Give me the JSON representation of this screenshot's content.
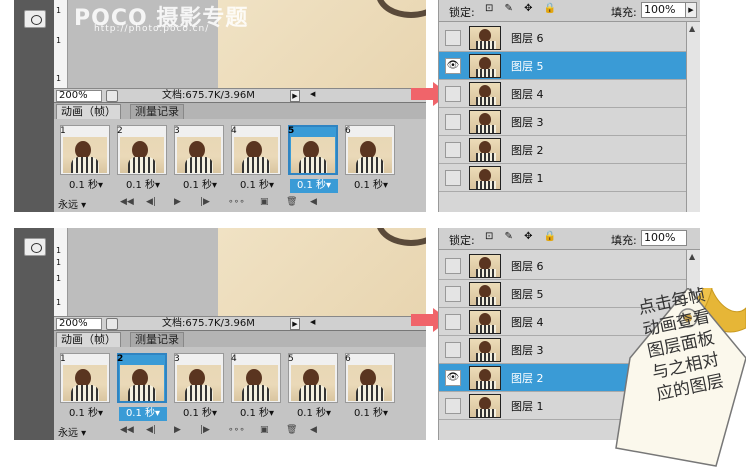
{
  "watermark": {
    "brand": "POCO 摄影专题",
    "url": "http://photo.poco.cn/"
  },
  "top_panel": {
    "zoom": "200%",
    "doc_info": "文档:675.7K/3.96M",
    "ruler_marks": [
      "1",
      "1",
      "1"
    ],
    "tabs": {
      "animation": "动画（帧）",
      "measure": "测量记录"
    },
    "frames": [
      {
        "num": "1",
        "delay": "0.1 秒▾"
      },
      {
        "num": "2",
        "delay": "0.1 秒▾"
      },
      {
        "num": "3",
        "delay": "0.1 秒▾"
      },
      {
        "num": "4",
        "delay": "0.1 秒▾"
      },
      {
        "num": "5",
        "delay": "0.1 秒▾"
      },
      {
        "num": "6",
        "delay": "0.1 秒▾"
      }
    ],
    "selected_frame": 5,
    "loop": "永远 ▾",
    "controls": [
      "◀◀",
      "◀|",
      "▶",
      "|▶",
      "∘∘∘",
      "▣",
      "🗑",
      "◀"
    ]
  },
  "bottom_panel": {
    "zoom": "200%",
    "doc_info": "文档:675.7K/3.96M",
    "ruler_marks": [
      "1",
      "1",
      "1",
      "1"
    ],
    "tabs": {
      "animation": "动画（帧）",
      "measure": "测量记录"
    },
    "frames": [
      {
        "num": "1",
        "delay": "0.1 秒▾"
      },
      {
        "num": "2",
        "delay": "0.1 秒▾"
      },
      {
        "num": "3",
        "delay": "0.1 秒▾"
      },
      {
        "num": "4",
        "delay": "0.1 秒▾"
      },
      {
        "num": "5",
        "delay": "0.1 秒▾"
      },
      {
        "num": "6",
        "delay": "0.1 秒▾"
      }
    ],
    "selected_frame": 2,
    "loop": "永远 ▾",
    "controls": [
      "◀◀",
      "◀|",
      "▶",
      "|▶",
      "∘∘∘",
      "▣",
      "🗑",
      "◀"
    ]
  },
  "layers_top": {
    "lock_label": "锁定:",
    "lock_icons": "⊡ ✎ ✥ 🔒",
    "fill_label": "填充:",
    "fill_value": "100%",
    "layers": [
      "图层 6",
      "图层 5",
      "图层 4",
      "图层 3",
      "图层 2",
      "图层 1"
    ],
    "selected_layer": "图层 5"
  },
  "layers_bottom": {
    "lock_label": "锁定:",
    "lock_icons": "⊡ ✎ ✥ 🔒",
    "fill_label": "填充:",
    "fill_value": "100%",
    "layers": [
      "图层 6",
      "图层 5",
      "图层 4",
      "图层 3",
      "图层 2",
      "图层 1"
    ],
    "selected_layer": "图层 2"
  },
  "tag_note": [
    "点击每帧",
    "动画查看",
    "图层面板",
    "与之相对",
    "应的图层"
  ],
  "colors": {
    "selection": "#3a9bd6",
    "arrow": "#f0646a",
    "ribbon": "#e6b637"
  },
  "icons": {
    "eye": "eye-icon",
    "arrow": "arrow-right-icon",
    "tool": "camera-icon"
  }
}
